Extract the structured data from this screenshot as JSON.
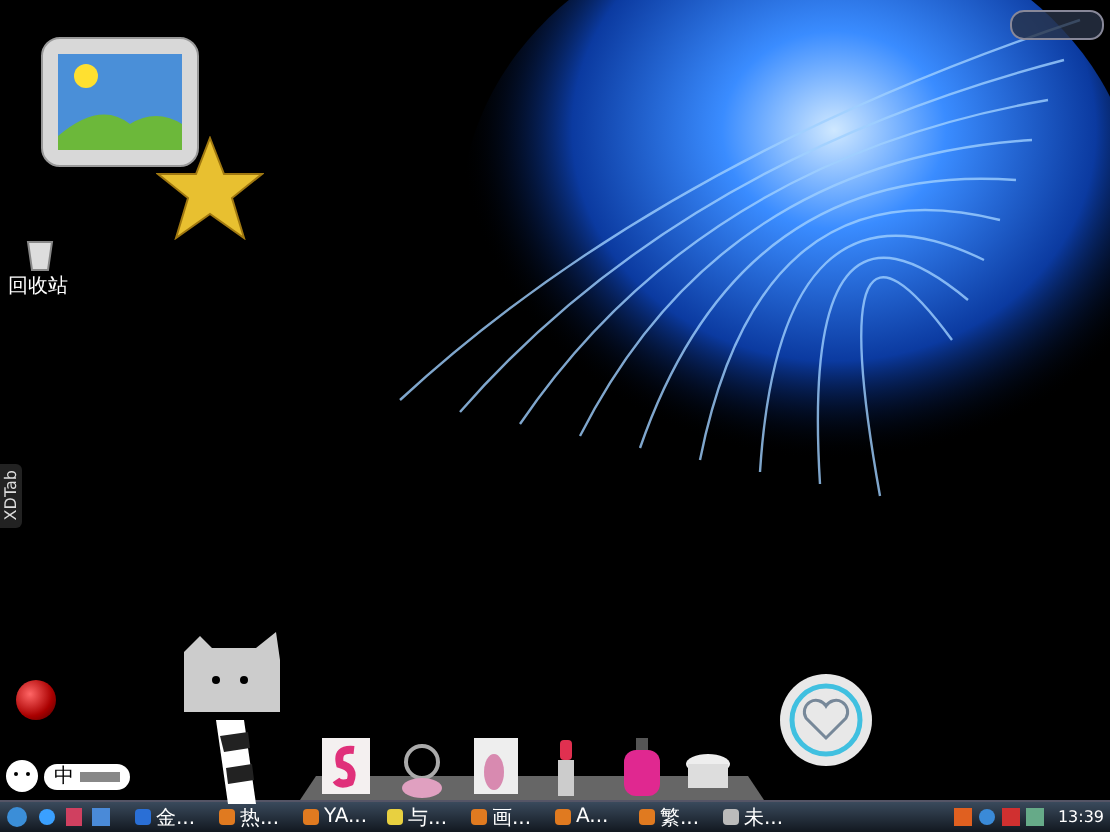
{
  "desktop": {
    "icons": [
      {
        "label": "回收站"
      }
    ],
    "side_tab": {
      "label": "XDTab"
    }
  },
  "ime_bar": {
    "label": "中"
  },
  "taskbar": {
    "tasks": [
      {
        "label": "金..."
      },
      {
        "label": "热..."
      },
      {
        "label": "YA..."
      },
      {
        "label": "与..."
      },
      {
        "label": "画..."
      },
      {
        "label": "A..."
      },
      {
        "label": "繁..."
      },
      {
        "label": "未..."
      }
    ],
    "clock": "13:39"
  }
}
